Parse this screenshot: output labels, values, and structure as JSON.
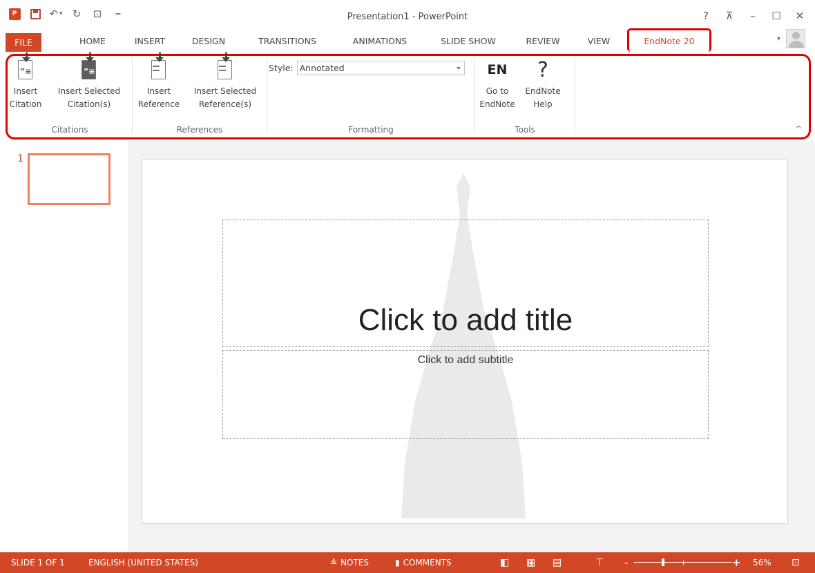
{
  "window": {
    "title": "Presentation1 - PowerPoint",
    "help": "?",
    "ribbon_display": "⊼",
    "minimize": "–",
    "maximize": "☐",
    "close": "✕"
  },
  "qat": {
    "app_logo": "P",
    "undo": "↶",
    "undo_dropdown": "▾",
    "redo": "↻",
    "start_slideshow": "⊡",
    "customize": "="
  },
  "tabs": [
    {
      "label": "FILE"
    },
    {
      "label": "HOME"
    },
    {
      "label": "INSERT"
    },
    {
      "label": "DESIGN"
    },
    {
      "label": "TRANSITIONS"
    },
    {
      "label": "ANIMATIONS"
    },
    {
      "label": "SLIDE SHOW"
    },
    {
      "label": "REVIEW"
    },
    {
      "label": "VIEW"
    },
    {
      "label": "EndNote 20"
    }
  ],
  "account": {
    "dropdown": "▾"
  },
  "ribbon": {
    "citations": {
      "group_label": "Citations",
      "insert_citation": {
        "line1": "Insert",
        "line2": "Citation"
      },
      "insert_selected_citations": {
        "line1": "Insert Selected",
        "line2": "Citation(s)"
      }
    },
    "references": {
      "group_label": "References",
      "insert_reference": {
        "line1": "Insert",
        "line2": "Reference"
      },
      "insert_selected_references": {
        "line1": "Insert Selected",
        "line2": "Reference(s)"
      }
    },
    "formatting": {
      "group_label": "Formatting",
      "style_label": "Style:",
      "style_value": "Annotated"
    },
    "tools": {
      "group_label": "Tools",
      "go_to_endnote": {
        "icon_text": "EN",
        "line1": "Go to",
        "line2": "EndNote"
      },
      "endnote_help": {
        "icon_text": "?",
        "line1": "EndNote",
        "line2": "Help"
      }
    },
    "collapse": "^"
  },
  "thumbnails": [
    {
      "number": "1"
    }
  ],
  "slide": {
    "title_placeholder": "Click to add title",
    "subtitle_placeholder": "Click to add subtitle"
  },
  "status": {
    "slide_info": "SLIDE 1 OF 1",
    "language": "ENGLISH (UNITED STATES)",
    "notes": "NOTES",
    "comments": "COMMENTS",
    "zoom_minus": "-",
    "zoom_plus": "+",
    "zoom_level": "56%",
    "fit_slide": "⊡"
  },
  "colors": {
    "accent": "#d24726",
    "highlight": "#e00000",
    "thumbnail_border": "#f0805f"
  }
}
